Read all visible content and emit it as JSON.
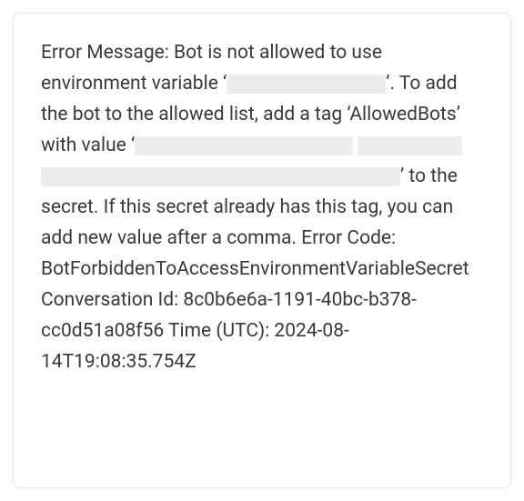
{
  "error": {
    "intro": "Error Message: Bot is not allowed to use environment variable ‘",
    "afterVar": "’. To add the bot to the allowed list, add a tag ‘AllowedBots’ with value ‘",
    "afterValue": "’ to the secret. If this secret already has this tag, you can add new value after a comma. Error Code: BotForbiddenToAccessEnvironmentVariableSecret Conversation Id: 8c0b6e6a-1191-40bc-b378-cc0d51a08f56 Time (UTC): 2024-08-14T19:08:35.754Z"
  }
}
